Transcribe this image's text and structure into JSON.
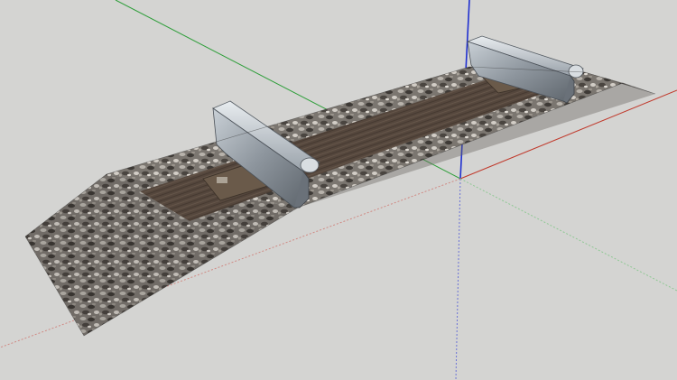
{
  "app": {
    "window_type": "3d-modeling-viewport"
  },
  "scene": {
    "background_color": "#d4d4d2",
    "axes": {
      "red_axis_color": "#c0392b",
      "green_axis_color": "#2e9e3a",
      "blue_axis_color": "#1f2fd0"
    },
    "model": {
      "description_icon": "railway-track-model",
      "ballast_color": "#7a746c",
      "tie_color": "#5a4b3f",
      "rail_color": "#9aa2aa"
    }
  }
}
